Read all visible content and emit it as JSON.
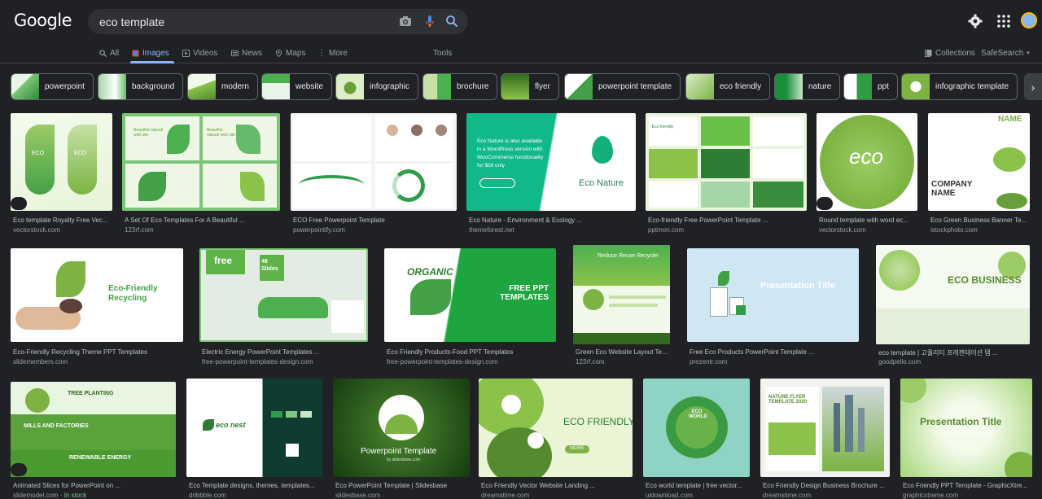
{
  "header": {
    "logo": "Google",
    "query": "eco template"
  },
  "tabs": [
    {
      "label": "All"
    },
    {
      "label": "Images"
    },
    {
      "label": "Videos"
    },
    {
      "label": "News"
    },
    {
      "label": "Maps"
    },
    {
      "label": "More"
    }
  ],
  "tools_label": "Tools",
  "collections_label": "Collections",
  "safesearch_label": "SafeSearch",
  "chips": [
    {
      "label": "powerpoint"
    },
    {
      "label": "background"
    },
    {
      "label": "modern"
    },
    {
      "label": "website"
    },
    {
      "label": "infographic"
    },
    {
      "label": "brochure"
    },
    {
      "label": "flyer"
    },
    {
      "label": "powerpoint template"
    },
    {
      "label": "eco friendly"
    },
    {
      "label": "nature"
    },
    {
      "label": "ppt"
    },
    {
      "label": "infographic template"
    }
  ],
  "results": [
    {
      "title": "Eco template Royalty Free Vec...",
      "source": "vectorstock.com",
      "img_text": "ECO"
    },
    {
      "title": "A Set Of Eco Templates For A Beautiful ...",
      "source": "123rf.com",
      "img_text": "Beautiful natural web site"
    },
    {
      "title": "ECO Free Powerpoint Template",
      "source": "powerpointify.com",
      "img_text": ""
    },
    {
      "title": "Eco Nature - Environment & Ecology ...",
      "source": "themeforest.net",
      "img_text": "Eco Nature is also available in a WordPress version with WooCommerce functionality for $58 only",
      "img_text2": "Eco Nature"
    },
    {
      "title": "Eco-friendly Free PowerPoint Template ...",
      "source": "pptmon.com",
      "img_text": "Eco friendly"
    },
    {
      "title": "Round template with word ec...",
      "source": "vectorstock.com",
      "img_text": "eco"
    },
    {
      "title": "Eco Green Business Banner Te...",
      "source": "istockphoto.com",
      "img_text": "NAME",
      "img_text2": "COMPANY NAME"
    },
    {
      "title": "Eco-Friendly Recycling Theme PPT Templates",
      "source": "slidemembers.com",
      "img_text": "Eco-Friendly Recycling"
    },
    {
      "title": "Electric Energy PowerPoint Templates ...",
      "source": "free-powerpoint-templates-design.com",
      "img_text": "free",
      "img_text2": "48 Slides"
    },
    {
      "title": "Eco Friendly Products-Food PPT Templates",
      "source": "free-powerpoint-templates-design.com",
      "img_text": "ORGANIC",
      "img_text2": "FREE PPT TEMPLATES"
    },
    {
      "title": "Green Eco Website Layout Tem...",
      "source": "123rf.com",
      "img_text": "Reduce Reuse Recycle!"
    },
    {
      "title": "Free Eco Products PowerPoint Template ...",
      "source": "prezentr.com",
      "img_text": "Presentation Title"
    },
    {
      "title": "eco template | 고퀄리티 프레젠테이션 템 ...",
      "source": "goodpello.com",
      "img_text": "ECO BUSINESS"
    },
    {
      "title": "Animated Slices for PowerPoint on ...",
      "source": "slidemodel.com",
      "stock": "In stock",
      "img_text": "TREE PLANTING",
      "img_text2": "MILLS AND FACTORIES",
      "img_text3": "RENEWABLE ENERGY"
    },
    {
      "title": "Eco Template designs, themes, templates...",
      "source": "dribbble.com",
      "img_text": "eco nest"
    },
    {
      "title": "Eco PowerPoint Template | Slidesbase",
      "source": "slidesbase.com",
      "img_text": "Powerpoint Template",
      "img_text2": "by slidesbase.com"
    },
    {
      "title": "Eco Friendly Vector Website Landing ...",
      "source": "dreamstime.com",
      "img_text": "ECO FRIENDLY",
      "img_text2": "MORE"
    },
    {
      "title": "Eco world template | free vector...",
      "source": "uidownload.com",
      "img_text": "ECO WORLD"
    },
    {
      "title": "Eco Friendly Design Business Brochure ...",
      "source": "dreamstime.com",
      "img_text": "NATURE FLYER TEMPLATE 2020"
    },
    {
      "title": "Eco Friendly PPT Template - GraphicXtre...",
      "source": "graphicxtreme.com",
      "img_text": "Presentation Title",
      "img_text2": "www.free-ppt-templates.com"
    }
  ],
  "colors": {
    "background": "#202124",
    "accent": "#8ab4f8",
    "title": "#bdc1c6",
    "source": "#9aa0a6",
    "green": "#3fa83a"
  }
}
